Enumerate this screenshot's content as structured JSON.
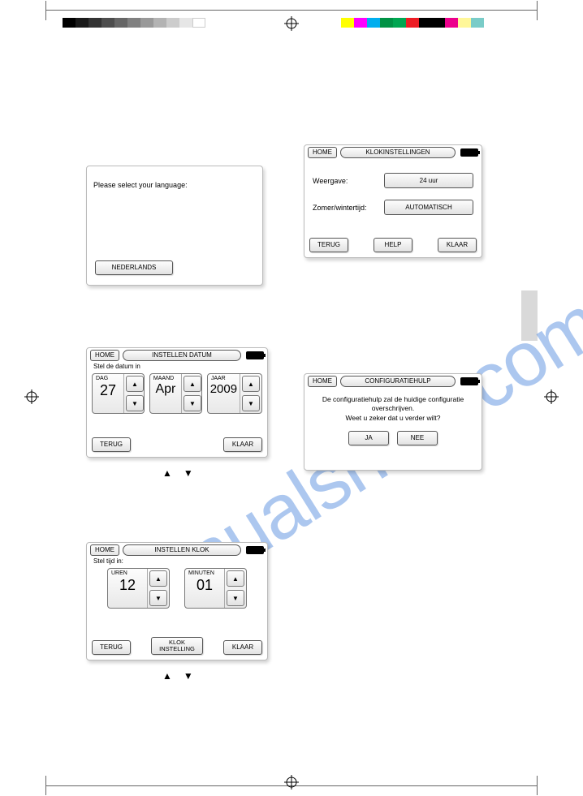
{
  "watermark": "manualshive.com",
  "panels": {
    "lang": {
      "prompt": "Please select your language:",
      "option": "NEDERLANDS"
    },
    "clock": {
      "home": "HOME",
      "title": "KLOKINSTELLINGEN",
      "row1_label": "Weergave:",
      "row1_value": "24 uur",
      "row2_label": "Zomer/wintertijd:",
      "row2_value": "AUTOMATISCH",
      "back": "TERUG",
      "help": "HELP",
      "done": "KLAAR"
    },
    "date": {
      "home": "HOME",
      "title": "INSTELLEN DATUM",
      "subtitle": "Stel de datum in",
      "day_label": "DAG",
      "day_value": "27",
      "month_label": "MAAND",
      "month_value": "Apr",
      "year_label": "JAAR",
      "year_value": "2009",
      "back": "TERUG",
      "done": "KLAAR"
    },
    "config": {
      "home": "HOME",
      "title": "CONFIGURATIEHULP",
      "line1": "De configuratiehulp zal de huidige configuratie overschrijven.",
      "line2": "Weet u zeker dat u verder wilt?",
      "yes": "JA",
      "no": "NEE"
    },
    "time": {
      "home": "HOME",
      "title": "INSTELLEN KLOK",
      "subtitle": "Stel tijd in:",
      "hours_label": "UREN",
      "hours_value": "12",
      "minutes_label": "MINUTEN",
      "minutes_value": "01",
      "back": "TERUG",
      "clock_line1": "KLOK",
      "clock_line2": "INSTELLING",
      "done": "KLAAR"
    }
  },
  "arrows": {
    "up": "▲",
    "down": "▼"
  },
  "print": {
    "grayscale": [
      "#000000",
      "#1a1a1a",
      "#333333",
      "#4d4d4d",
      "#666666",
      "#808080",
      "#999999",
      "#b3b3b3",
      "#cccccc",
      "#e6e6e6",
      "#ffffff"
    ],
    "colors": [
      "#ffff00",
      "#00aeef",
      "#00a651",
      "#ed1c24",
      "#000000",
      "#ec008c",
      "#fff200",
      "#00adee"
    ]
  }
}
